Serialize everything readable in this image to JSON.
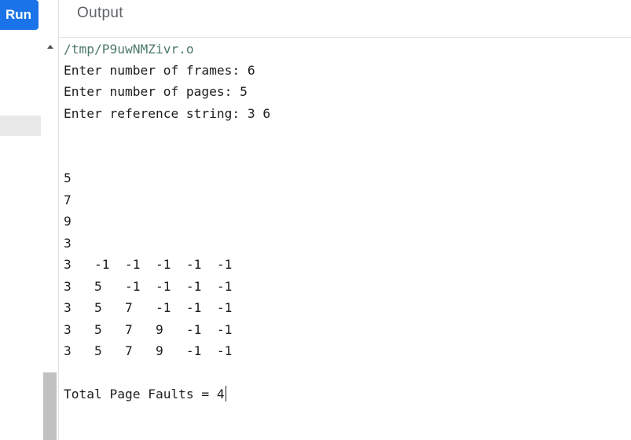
{
  "toolbar": {
    "run_label": "Run"
  },
  "output": {
    "title": "Output",
    "lines": [
      "/tmp/P9uwNMZivr.o",
      "Enter number of frames: 6",
      "Enter number of pages: 5",
      "Enter reference string: 3 6",
      "",
      "",
      "5",
      "7",
      "9",
      "3",
      "3   -1  -1  -1  -1  -1",
      "3   5   -1  -1  -1  -1",
      "3   5   7   -1  -1  -1",
      "3   5   7   9   -1  -1",
      "3   5   7   9   -1  -1",
      "",
      "Total Page Faults = 4"
    ]
  },
  "colors": {
    "run_button": "#1a73e8",
    "path_text": "#4e7a68",
    "console_text": "#1c1c1c",
    "header_text": "#5f6368"
  }
}
